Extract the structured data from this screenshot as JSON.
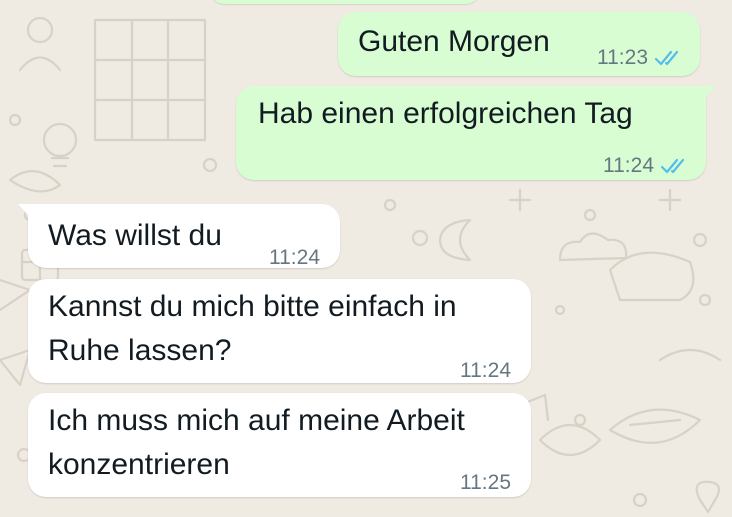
{
  "messages": [
    {
      "direction": "outgoing",
      "text": "Guten Morgen",
      "time": "11:23",
      "status": "read"
    },
    {
      "direction": "outgoing",
      "text": "Hab einen erfolgreichen Tag",
      "time": "11:24",
      "status": "read"
    },
    {
      "direction": "incoming",
      "text": "Was willst du",
      "time": "11:24"
    },
    {
      "direction": "incoming",
      "lines": [
        "Kannst du mich bitte einfach in",
        "Ruhe lassen?"
      ],
      "time": "11:24"
    },
    {
      "direction": "incoming",
      "lines": [
        "Ich muss mich auf meine Arbeit",
        "konzentrieren"
      ],
      "time": "11:25"
    }
  ],
  "colors": {
    "outgoing_bubble": "#d9fdd3",
    "incoming_bubble": "#ffffff",
    "chat_background": "#efeae2",
    "read_tick": "#53bdeb",
    "timestamp": "#667781"
  },
  "icons": {
    "read_receipt": "double-check-icon"
  }
}
